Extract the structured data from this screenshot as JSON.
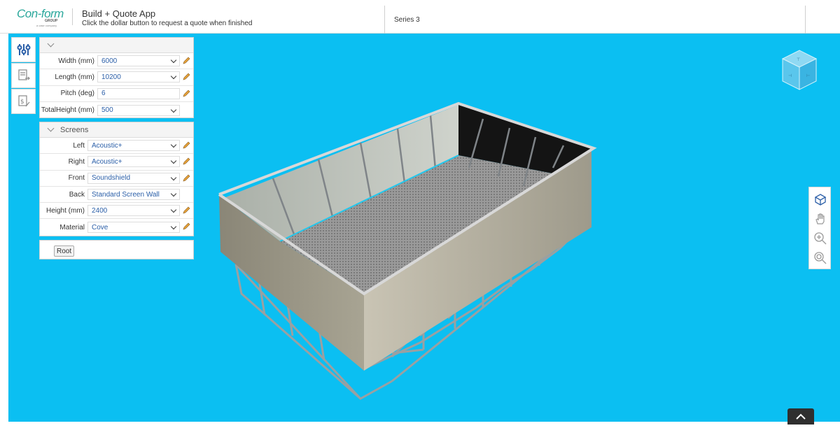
{
  "header": {
    "logo_main": "Con-form",
    "logo_group": "GROUP",
    "logo_sub": "a case company",
    "app_title": "Build + Quote App",
    "app_subtitle": "Click the dollar button to request a quote when finished",
    "series": "Series 3"
  },
  "side_tabs": [
    "sliders-icon",
    "document-arrow-icon",
    "dollar-pencil-icon"
  ],
  "dimensions": [
    {
      "label": "Width (mm)",
      "value": "6000",
      "dropdown": true,
      "editable": true
    },
    {
      "label": "Length (mm)",
      "value": "10200",
      "dropdown": true,
      "editable": true
    },
    {
      "label": "Pitch (deg)",
      "value": "6",
      "dropdown": false,
      "editable": true
    },
    {
      "label": "TotalHeight (mm)",
      "value": "500",
      "dropdown": true,
      "editable": false
    }
  ],
  "screens": {
    "title": "Screens",
    "rows": [
      {
        "label": "Left",
        "value": "Acoustic+",
        "editable": true
      },
      {
        "label": "Right",
        "value": "Acoustic+",
        "editable": true
      },
      {
        "label": "Front",
        "value": "Soundshield",
        "editable": true
      },
      {
        "label": "Back",
        "value": "Standard Screen Wall",
        "editable": false
      },
      {
        "label": "Height (mm)",
        "value": "2400",
        "editable": true
      },
      {
        "label": "Material",
        "value": "Cove",
        "editable": true
      }
    ]
  },
  "root_button": "Root",
  "right_tools": [
    "cube-view-icon",
    "pan-hand-icon",
    "zoom-in-icon",
    "zoom-fit-icon"
  ],
  "colors": {
    "viewport": "#0bbff2",
    "accent": "#2aa79b",
    "field_text": "#2b5fa8"
  }
}
